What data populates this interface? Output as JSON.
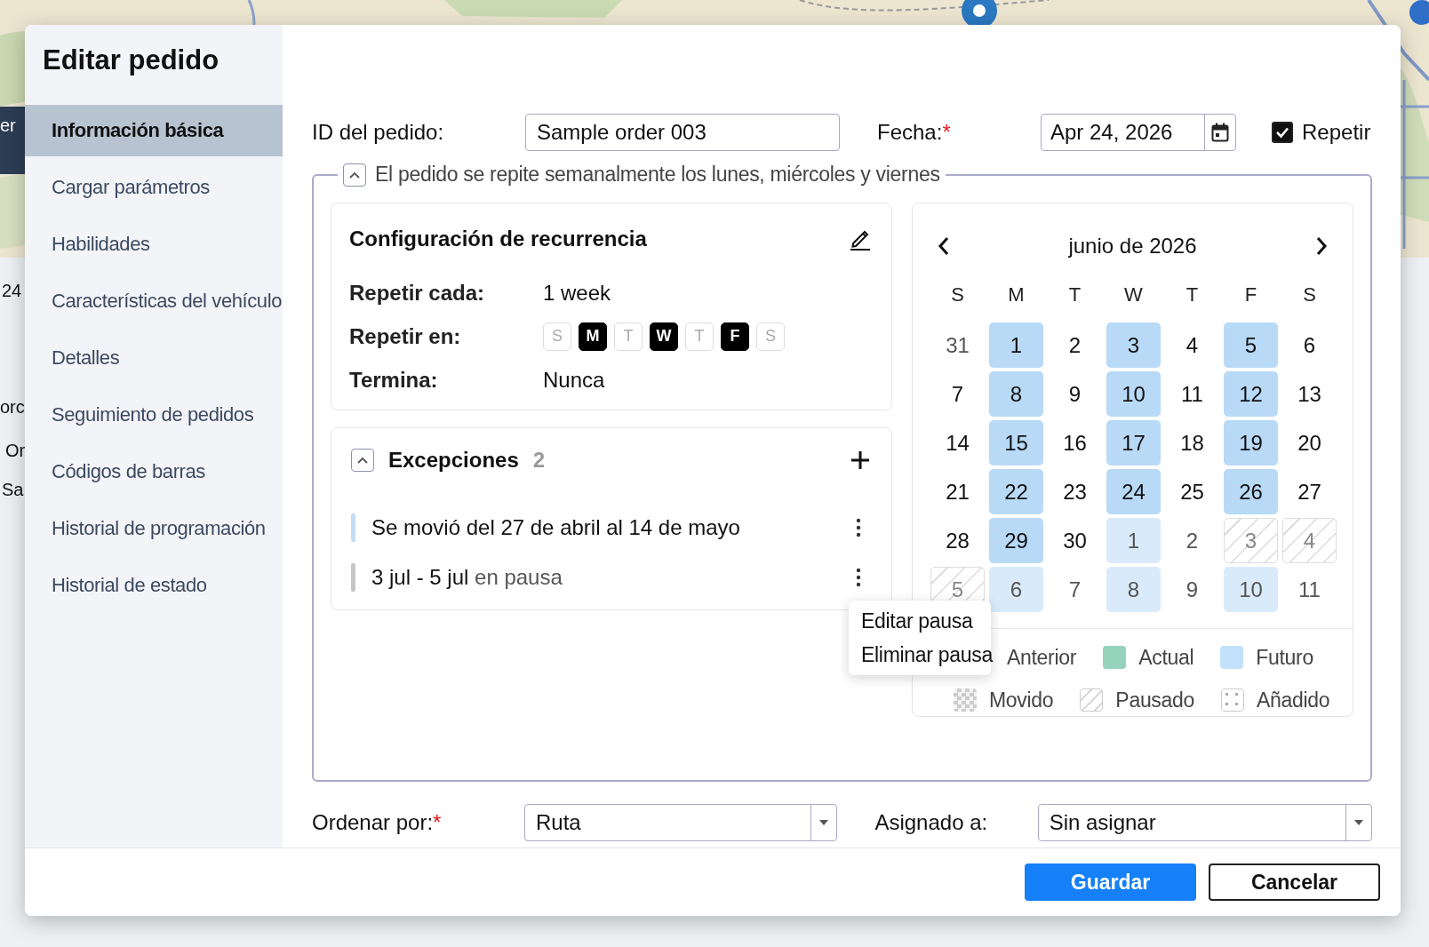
{
  "background": {
    "fragments": [
      "er",
      "24",
      "orc",
      "Or",
      "Sa"
    ]
  },
  "dialog": {
    "title": "Editar pedido"
  },
  "sidebar": {
    "items": [
      {
        "label": "Información básica",
        "selected": true
      },
      {
        "label": "Cargar parámetros",
        "selected": false
      },
      {
        "label": "Habilidades",
        "selected": false
      },
      {
        "label": "Características del vehículo",
        "selected": false
      },
      {
        "label": "Detalles",
        "selected": false
      },
      {
        "label": "Seguimiento de pedidos",
        "selected": false
      },
      {
        "label": "Códigos de barras",
        "selected": false
      },
      {
        "label": "Historial de programación",
        "selected": false
      },
      {
        "label": "Historial de estado",
        "selected": false
      }
    ]
  },
  "order_id": {
    "label": "ID del pedido:",
    "value": "Sample order 003"
  },
  "date": {
    "label": "Fecha:",
    "required_mark": "*",
    "value": "Apr 24, 2026"
  },
  "repeat": {
    "label": "Repetir",
    "checked": true
  },
  "recurrence_section": {
    "expanded": true,
    "summary": "El pedido se repite semanalmente los lunes, miércoles y viernes"
  },
  "recurrence": {
    "title": "Configuración de recurrencia",
    "every_label": "Repetir cada:",
    "every_value": "1 week",
    "on_label": "Repetir en:",
    "days": [
      {
        "label": "S",
        "on": false
      },
      {
        "label": "M",
        "on": true
      },
      {
        "label": "T",
        "on": false
      },
      {
        "label": "W",
        "on": true
      },
      {
        "label": "T",
        "on": false
      },
      {
        "label": "F",
        "on": true
      },
      {
        "label": "S",
        "on": false
      }
    ],
    "ends_label": "Termina:",
    "ends_value": "Nunca"
  },
  "exceptions": {
    "title": "Excepciones",
    "count": "2",
    "expanded": true,
    "items": [
      {
        "kind": "moved",
        "text": "Se movió del 27 de abril al 14 de mayo"
      },
      {
        "kind": "paused",
        "text": "3 jul - 5 jul",
        "status": "en pausa",
        "menu": [
          "Editar pausa",
          "Eliminar pausa"
        ]
      }
    ]
  },
  "calendar": {
    "month": "junio de 2026",
    "weekdays": [
      "S",
      "M",
      "T",
      "W",
      "T",
      "F",
      "S"
    ],
    "weeks": [
      [
        {
          "label": "31",
          "kind": "plain",
          "outside": true
        },
        {
          "label": "1",
          "kind": "future",
          "outside": false
        },
        {
          "label": "2",
          "kind": "plain",
          "outside": false
        },
        {
          "label": "3",
          "kind": "future",
          "outside": false
        },
        {
          "label": "4",
          "kind": "plain",
          "outside": false
        },
        {
          "label": "5",
          "kind": "future",
          "outside": false
        },
        {
          "label": "6",
          "kind": "plain",
          "outside": false
        }
      ],
      [
        {
          "label": "7",
          "kind": "plain",
          "outside": false
        },
        {
          "label": "8",
          "kind": "future",
          "outside": false
        },
        {
          "label": "9",
          "kind": "plain",
          "outside": false
        },
        {
          "label": "10",
          "kind": "future",
          "outside": false
        },
        {
          "label": "11",
          "kind": "plain",
          "outside": false
        },
        {
          "label": "12",
          "kind": "future",
          "outside": false
        },
        {
          "label": "13",
          "kind": "plain",
          "outside": false
        }
      ],
      [
        {
          "label": "14",
          "kind": "plain",
          "outside": false
        },
        {
          "label": "15",
          "kind": "future",
          "outside": false
        },
        {
          "label": "16",
          "kind": "plain",
          "outside": false
        },
        {
          "label": "17",
          "kind": "future",
          "outside": false
        },
        {
          "label": "18",
          "kind": "plain",
          "outside": false
        },
        {
          "label": "19",
          "kind": "future",
          "outside": false
        },
        {
          "label": "20",
          "kind": "plain",
          "outside": false
        }
      ],
      [
        {
          "label": "21",
          "kind": "plain",
          "outside": false
        },
        {
          "label": "22",
          "kind": "future",
          "outside": false
        },
        {
          "label": "23",
          "kind": "plain",
          "outside": false
        },
        {
          "label": "24",
          "kind": "future",
          "outside": false
        },
        {
          "label": "25",
          "kind": "plain",
          "outside": false
        },
        {
          "label": "26",
          "kind": "future",
          "outside": false
        },
        {
          "label": "27",
          "kind": "plain",
          "outside": false
        }
      ],
      [
        {
          "label": "28",
          "kind": "plain",
          "outside": false
        },
        {
          "label": "29",
          "kind": "future",
          "outside": false
        },
        {
          "label": "30",
          "kind": "plain",
          "outside": false
        },
        {
          "label": "1",
          "kind": "future",
          "outside": true
        },
        {
          "label": "2",
          "kind": "plain",
          "outside": true
        },
        {
          "label": "3",
          "kind": "paused",
          "outside": true
        },
        {
          "label": "4",
          "kind": "paused",
          "outside": true
        }
      ],
      [
        {
          "label": "5",
          "kind": "paused",
          "outside": true
        },
        {
          "label": "6",
          "kind": "future",
          "outside": true
        },
        {
          "label": "7",
          "kind": "plain",
          "outside": true
        },
        {
          "label": "8",
          "kind": "future",
          "outside": true
        },
        {
          "label": "9",
          "kind": "plain",
          "outside": true
        },
        {
          "label": "10",
          "kind": "future",
          "outside": true
        },
        {
          "label": "11",
          "kind": "plain",
          "outside": true
        }
      ]
    ],
    "legend_rows": [
      [
        {
          "label": "Anterior",
          "kind": "past"
        },
        {
          "label": "Actual",
          "kind": "current"
        },
        {
          "label": "Futuro",
          "kind": "future"
        }
      ],
      [
        {
          "label": "Movido",
          "kind": "moved"
        },
        {
          "label": "Pausado",
          "kind": "paused"
        },
        {
          "label": "Añadido",
          "kind": "added"
        }
      ]
    ]
  },
  "sort": {
    "label": "Ordenar por:",
    "required_mark": "*",
    "value": "Ruta"
  },
  "assigned": {
    "label": "Asignado a:",
    "value": "Sin asignar"
  },
  "buttons": [
    {
      "label": "Guardar",
      "kind": "primary"
    },
    {
      "label": "Cancelar",
      "kind": "secondary"
    }
  ]
}
